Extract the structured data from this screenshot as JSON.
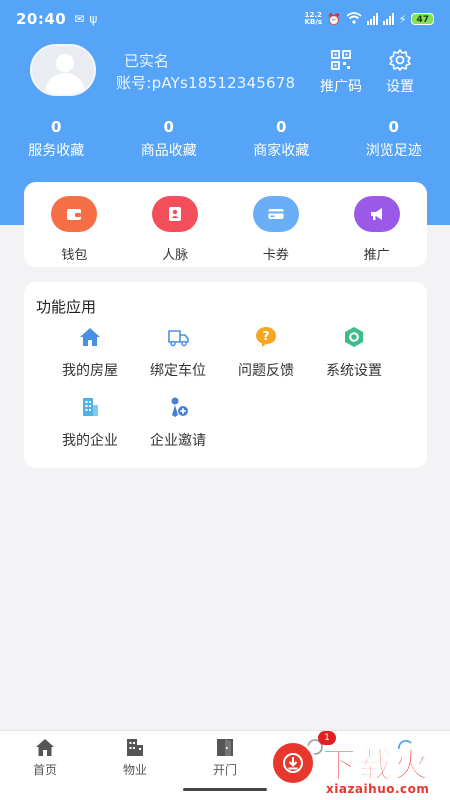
{
  "status_bar": {
    "time": "20:40",
    "net_speed": "12.2\nKB/s",
    "battery": "47"
  },
  "profile": {
    "name": "已实名",
    "account": "账号:pAYs18512345678",
    "promo_code_label": "推广码",
    "settings_label": "设置"
  },
  "stats": [
    {
      "value": "0",
      "label": "服务收藏"
    },
    {
      "value": "0",
      "label": "商品收藏"
    },
    {
      "value": "0",
      "label": "商家收藏"
    },
    {
      "value": "0",
      "label": "浏览足迹"
    }
  ],
  "wallet_row": [
    {
      "label": "钱包",
      "icon": "wallet-icon",
      "color": "#f56e45"
    },
    {
      "label": "人脉",
      "icon": "contacts-icon",
      "color": "#f24f5b"
    },
    {
      "label": "卡券",
      "icon": "card-icon",
      "color": "#6aaef7"
    },
    {
      "label": "推广",
      "icon": "megaphone-icon",
      "color": "#9b59e8"
    }
  ],
  "functions": {
    "title": "功能应用",
    "items": [
      {
        "label": "我的房屋",
        "icon": "house-icon",
        "color": "#4a90e2"
      },
      {
        "label": "绑定车位",
        "icon": "truck-icon",
        "color": "#4a90e2"
      },
      {
        "label": "问题反馈",
        "icon": "question-icon",
        "color": "#f5a623"
      },
      {
        "label": "系统设置",
        "icon": "settings-hex-icon",
        "color": "#3cbd8a"
      },
      {
        "label": "我的企业",
        "icon": "building-icon",
        "color": "#4fb3e8"
      },
      {
        "label": "企业邀请",
        "icon": "invite-icon",
        "color": "#4a7fd6"
      }
    ]
  },
  "tabbar": [
    {
      "label": "首页",
      "icon": "home-icon"
    },
    {
      "label": "物业",
      "icon": "property-icon"
    },
    {
      "label": "开门",
      "icon": "door-icon"
    }
  ],
  "tab_badge": "1",
  "watermark": {
    "brand": "下载火",
    "domain": "xiazaihuo.com"
  }
}
